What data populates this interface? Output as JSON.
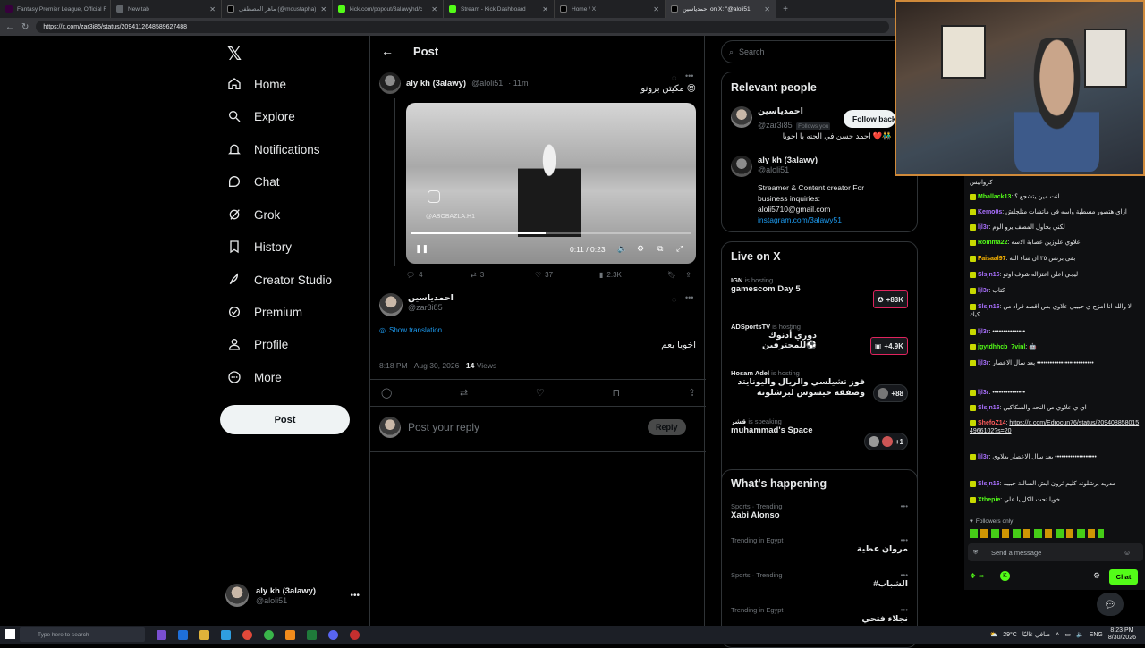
{
  "browser": {
    "tabs": [
      {
        "title": "Fantasy Premier League, Official F"
      },
      {
        "title": "New tab"
      },
      {
        "title": "ماهر المصطفى (@moustapha)"
      },
      {
        "title": "kick.com/popout/3alawyhd/c"
      },
      {
        "title": "Stream - Kick Dashboard"
      },
      {
        "title": "Home / X"
      },
      {
        "title": "احمدياسين on X: \"@aloli51"
      }
    ],
    "url": "https://x.com/zar3i85/status/2094112648589627488"
  },
  "nav": {
    "items": [
      {
        "label": "Home",
        "icon": "home-icon"
      },
      {
        "label": "Explore",
        "icon": "search-icon"
      },
      {
        "label": "Notifications",
        "icon": "bell-icon"
      },
      {
        "label": "Chat",
        "icon": "chat-bubble-icon"
      },
      {
        "label": "Grok",
        "icon": "grok-icon"
      },
      {
        "label": "History",
        "icon": "bookmark-icon"
      },
      {
        "label": "Creator Studio",
        "icon": "rocket-icon"
      },
      {
        "label": "Premium",
        "icon": "verified-badge-icon"
      },
      {
        "label": "Profile",
        "icon": "person-icon"
      },
      {
        "label": "More",
        "icon": "more-circle-icon"
      }
    ],
    "post_button": "Post",
    "account": {
      "name": "aly kh (3alawy)",
      "handle": "@aloli51"
    }
  },
  "main": {
    "header": "Post",
    "quoted_post": {
      "name": "aly kh (3alawy)",
      "handle": "@aloli51",
      "time": "· 11m",
      "text": "مكيتن برونو 😍",
      "video": {
        "watermark": "@ABOBAZLA.H1",
        "time": "0:11 / 0:23",
        "progress": 0.48
      },
      "replies": "4",
      "reposts": "3",
      "likes": "37",
      "views": "2.3K"
    },
    "reply_post": {
      "name": "احمدياسين",
      "handle": "@zar3i85",
      "show_translation": "Show translation",
      "text": "اخويا يعم",
      "timestamp": "8:18 PM · Aug 30, 2026 · ",
      "views_count": "14",
      "views_label": " Views"
    },
    "reply_box": {
      "placeholder": "Post your reply",
      "button": "Reply"
    }
  },
  "right": {
    "search_placeholder": "Search",
    "relevant": {
      "title": "Relevant people",
      "people": [
        {
          "name": "احمدياسين",
          "handle": "@zar3i85",
          "follows_you": "Follows you",
          "bio": "احمد حسن في الجنه يا اخويا ❤️👬",
          "button": "Follow back"
        },
        {
          "name": "aly kh (3alawy)",
          "handle": "@aloli51",
          "bio1": "Streamer & Content creator For business inquiries:",
          "bio2": "aloli5710@gmail.com",
          "link": "instagram.com/3alawy51"
        }
      ]
    },
    "live": {
      "title": "Live on X",
      "items": [
        {
          "host": "IGN",
          "status": "is hosting",
          "title": "gamescom Day 5",
          "count": "+83K"
        },
        {
          "host": "ADSportsTV",
          "status": "is hosting",
          "title": "دوري أدنوك للمحترفين⚽",
          "count": "+4.9K"
        },
        {
          "host": "Hosam Adel",
          "status": "is hosting",
          "title": "فوز تشيلسي والريال واليونايتد وصفقة خيسوس لبرشلونة",
          "count": "+88"
        },
        {
          "host": "قشر",
          "status": "is speaking",
          "title": "muhammad's Space",
          "count": "+1"
        }
      ]
    },
    "happening": {
      "title": "What's happening",
      "trends": [
        {
          "category": "Sports · Trending",
          "name": "Xabi Alonso"
        },
        {
          "category": "Trending in Egypt",
          "name": "مروان عطية"
        },
        {
          "category": "Sports · Trending",
          "name": "#الشباب"
        },
        {
          "category": "Trending in Egypt",
          "name": "نجلاء فتحي"
        }
      ]
    }
  },
  "chat": {
    "messages": [
      {
        "user": "",
        "text": "كروانيس"
      },
      {
        "user": "Mballack13",
        "text": "انت مين يتشجع ؟",
        "color": "#53fc18"
      },
      {
        "user": "Kemo0s",
        "text": "ازاي هتصور مسطبة واسه في ماتشات متلجلش",
        "color": "#a970ff"
      },
      {
        "user": "ljl3r",
        "text": "لكني بحاول المصف يرو الوم",
        "color": "#a970ff"
      },
      {
        "user": "Romma22",
        "text": "علاوي علوزين عصابة الاسه",
        "color": "#53fc18"
      },
      {
        "user": "Faisaal97",
        "text": "بقى برنس ٣٥ ان شاء الله",
        "color": "#ffb800"
      },
      {
        "user": "Slsjn16",
        "text": "ليجي اعلن اعتزاله شوف اوتو",
        "color": "#a970ff"
      },
      {
        "user": "ljl3r",
        "text": "كتاب",
        "color": "#a970ff"
      },
      {
        "user": "Slsjn16",
        "text": "لا والله انا امزح ي حبيبي علاوي بس اقصد قراد من كيك",
        "color": "#a970ff"
      },
      {
        "user": "ljl3r",
        "text": "•••••••••••••••",
        "color": "#a970ff"
      },
      {
        "user": "jgytdhhcb_7vinl",
        "text": "🤖",
        "color": "#53fc18"
      },
      {
        "user": "ljl3r",
        "text": "بعد سال الاعصار ••••••••••••••••••••••••••",
        "color": "#a970ff"
      },
      {
        "user": "ljl3r",
        "text": "•••••••••••••••",
        "color": "#a970ff"
      },
      {
        "user": "Slsjn16",
        "text": "اي ي علاوي ص النحه والسكاكين",
        "color": "#a970ff"
      },
      {
        "user": "ShefoZ14",
        "text": "https://x.com/Edrocun76/status/2094088580154966102?s=20",
        "color": "#ff5c5c"
      },
      {
        "user": "ljl3r",
        "text": "بعد سال الاعصار يعلاوي •••••••••••••••••••",
        "color": "#a970ff"
      },
      {
        "user": "Slsjn16",
        "text": "مدريد برشلونه كليم ثرون ايش السالنة حبيبه",
        "color": "#a970ff"
      },
      {
        "user": "Xthepie",
        "text": "خويا تحت الكل يا علي",
        "color": "#53fc18"
      }
    ],
    "followers_only": "Followers only",
    "input_placeholder": "Send a message",
    "points": "∞",
    "chat_button": "Chat"
  },
  "taskbar": {
    "search_placeholder": "Type here to search",
    "weather": "29°C",
    "weather_desc": "صافي غالبًا",
    "lang": "ENG",
    "time": "8:23 PM",
    "date": "8/30/2026"
  }
}
